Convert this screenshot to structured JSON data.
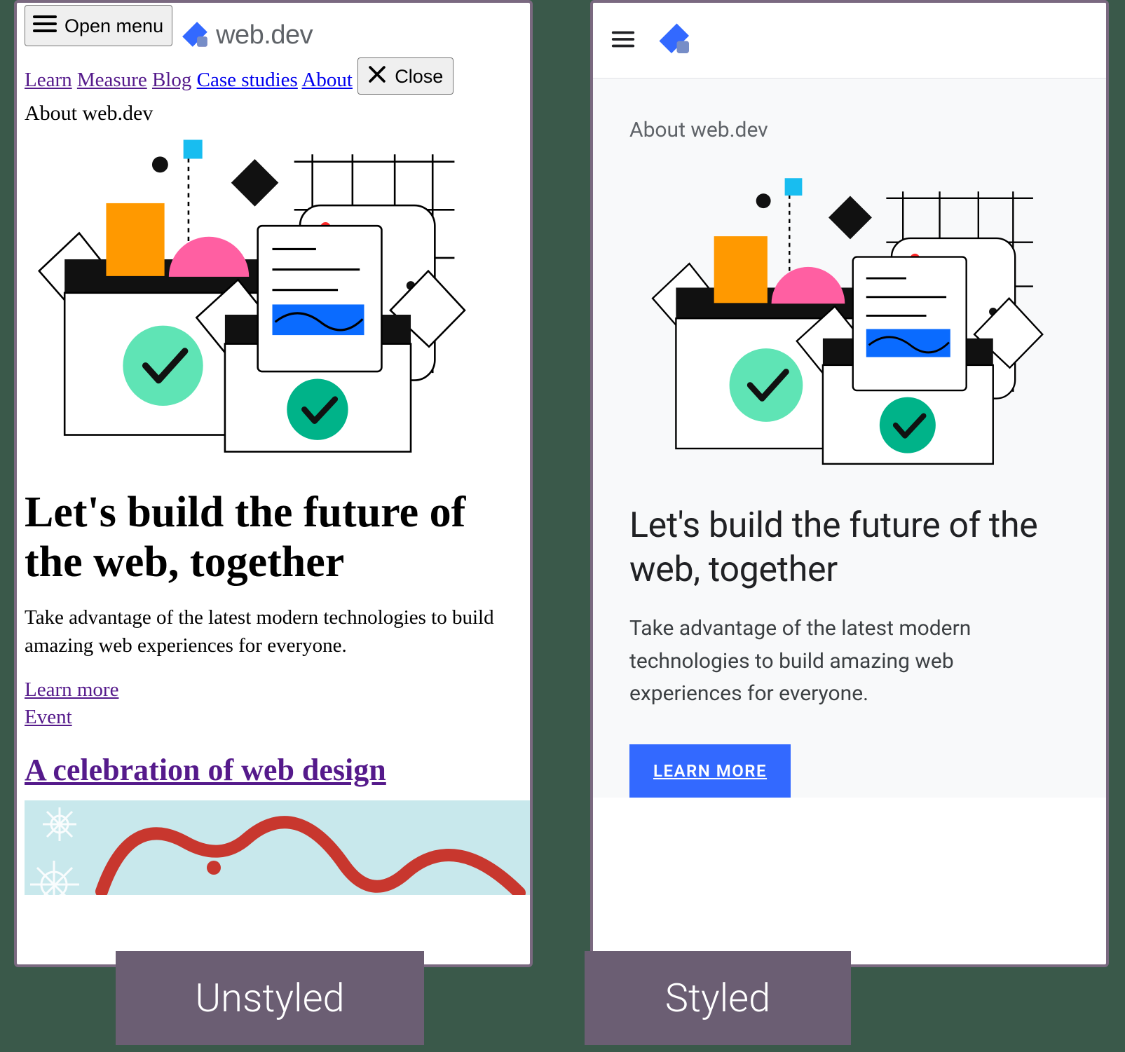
{
  "unstyled": {
    "open_menu": "Open menu",
    "brand": "web.dev",
    "nav": {
      "learn": "Learn",
      "measure": "Measure",
      "blog": "Blog",
      "case_studies": "Case studies",
      "about": "About"
    },
    "close": "Close",
    "eyebrow": "About web.dev",
    "h1": "Let's build the future of the web, together",
    "sub": "Take advantage of the latest modern technologies to build amazing web experiences for everyone.",
    "learn_more": "Learn more",
    "event": "Event",
    "h2": "A celebration of web design"
  },
  "styled": {
    "eyebrow": "About web.dev",
    "h1": "Let's build the future of the web, together",
    "sub": "Take advantage of the latest modern technologies to build amazing web experiences for everyone.",
    "cta": "LEARN MORE"
  },
  "captions": {
    "unstyled": "Unstyled",
    "styled": "Styled"
  }
}
